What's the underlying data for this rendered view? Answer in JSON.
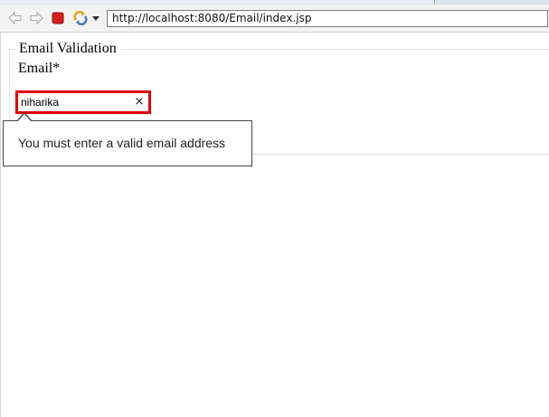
{
  "browser": {
    "toolbar": {
      "back_icon": "back-arrow-icon",
      "forward_icon": "forward-arrow-icon",
      "stop_icon": "stop-icon",
      "refresh_icon": "refresh-icon",
      "menu_icon": "chevron-down-icon"
    },
    "address_bar": {
      "url": "http://localhost:8080/Email/index.jsp"
    }
  },
  "page": {
    "fieldset_legend": "Email Validation",
    "email_label": "Email*",
    "email_input": {
      "value": "niharika"
    },
    "clear_glyph": "×",
    "validation_message": "You must enter a valid email address"
  },
  "colors": {
    "error_border": "#e00000",
    "stop_red": "#d32020"
  }
}
